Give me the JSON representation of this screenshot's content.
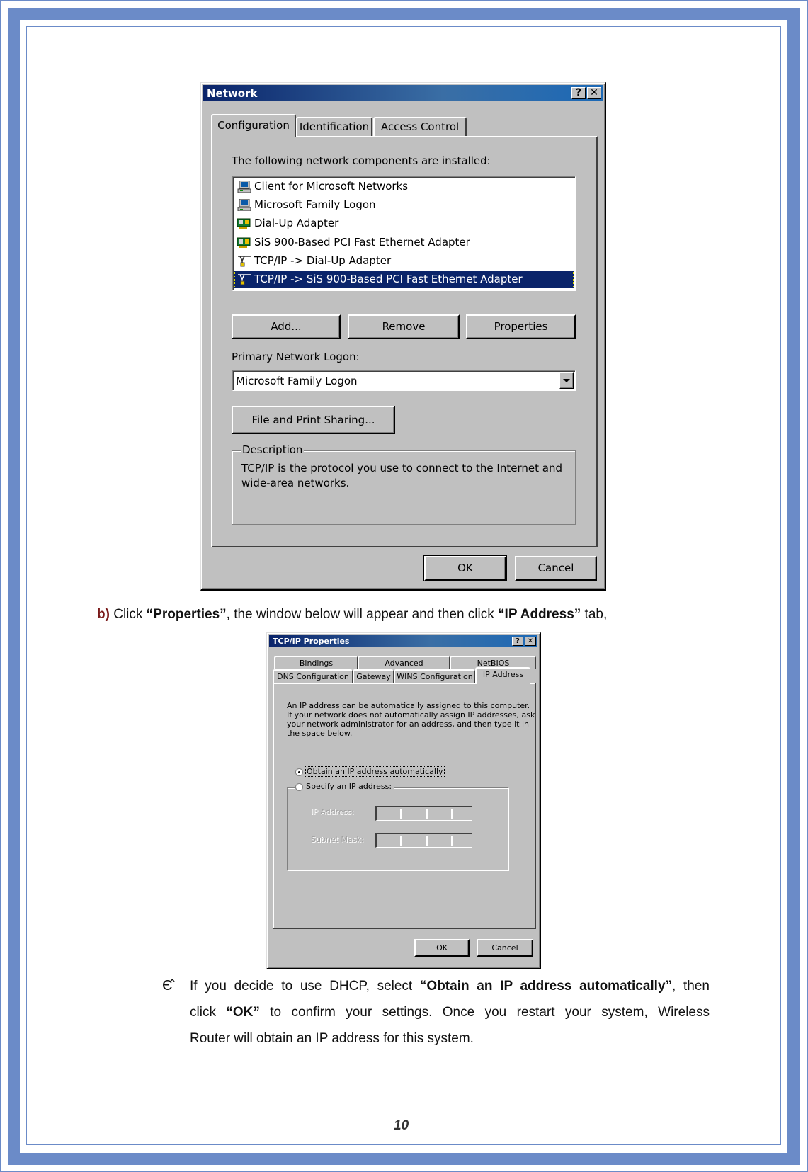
{
  "network_dialog": {
    "title": "Network",
    "help_button": "?",
    "close_button": "✕",
    "tabs": [
      {
        "label": "Configuration",
        "active": true
      },
      {
        "label": "Identification",
        "active": false
      },
      {
        "label": "Access Control",
        "active": false
      }
    ],
    "components_label": "The following network components are installed:",
    "components": [
      {
        "icon": "client-computer-icon",
        "label": "Client for Microsoft Networks",
        "selected": false
      },
      {
        "icon": "client-computer-icon",
        "label": "Microsoft Family Logon",
        "selected": false
      },
      {
        "icon": "network-adapter-icon",
        "label": "Dial-Up Adapter",
        "selected": false
      },
      {
        "icon": "network-adapter-icon",
        "label": "SiS 900-Based PCI Fast Ethernet Adapter",
        "selected": false
      },
      {
        "icon": "protocol-icon",
        "label": "TCP/IP -> Dial-Up Adapter",
        "selected": false
      },
      {
        "icon": "protocol-icon",
        "label": "TCP/IP -> SiS 900-Based PCI Fast Ethernet Adapter",
        "selected": true
      }
    ],
    "buttons": {
      "add": "Add...",
      "remove": "Remove",
      "properties": "Properties"
    },
    "primary_logon_label": "Primary Network Logon:",
    "primary_logon_value": "Microsoft Family Logon",
    "file_print_sharing": "File and Print Sharing...",
    "description_legend": "Description",
    "description_text_line1": "TCP/IP is the protocol you use to connect to the Internet and",
    "description_text_line2": "wide-area networks.",
    "ok": "OK",
    "cancel": "Cancel"
  },
  "step_b": {
    "marker": "b)",
    "text_1": " Click ",
    "bold_1": "“Properties”",
    "text_2": ", the window below will appear and then click ",
    "bold_2": "“IP Address”",
    "text_3": " tab,"
  },
  "tcpip_dialog": {
    "title": "TCP/IP Properties",
    "help_button": "?",
    "close_button": "✕",
    "tabs_row1": [
      "Bindings",
      "Advanced",
      "NetBIOS"
    ],
    "tabs_row2": [
      "DNS Configuration",
      "Gateway",
      "WINS Configuration",
      "IP Address"
    ],
    "active_tab": "IP Address",
    "intro_lines": [
      "An IP address can be automatically assigned to this computer.",
      "If your network does not automatically assign IP addresses, ask",
      "your network administrator for an address, and then type it in",
      "the space below."
    ],
    "option_auto": "Obtain an IP address automatically",
    "option_auto_selected": true,
    "option_specify": "Specify an IP address:",
    "option_specify_selected": false,
    "ip_address_label": "IP Address:",
    "subnet_mask_label": "Subnet Mask:",
    "ok": "OK",
    "cancel": "Cancel"
  },
  "bullet": {
    "symbol": "Є̂",
    "line1_a": "If you decide to use DHCP, select ",
    "line1_b": "“Obtain an IP address automatically”",
    "line1_c": ", then",
    "line2_a": "click ",
    "line2_b": "“OK”",
    "line2_c": " to confirm your settings. Once you restart your system, Wireless",
    "line3": "Router will obtain an IP address for this system."
  },
  "page_number": "10",
  "colors": {
    "frame_blue": "#6b8bc8",
    "marker_red": "#7a1a1a",
    "title_bar_dark": "#0a246a",
    "selection": "#0a246a",
    "dialog_gray": "#c0c0c0"
  }
}
